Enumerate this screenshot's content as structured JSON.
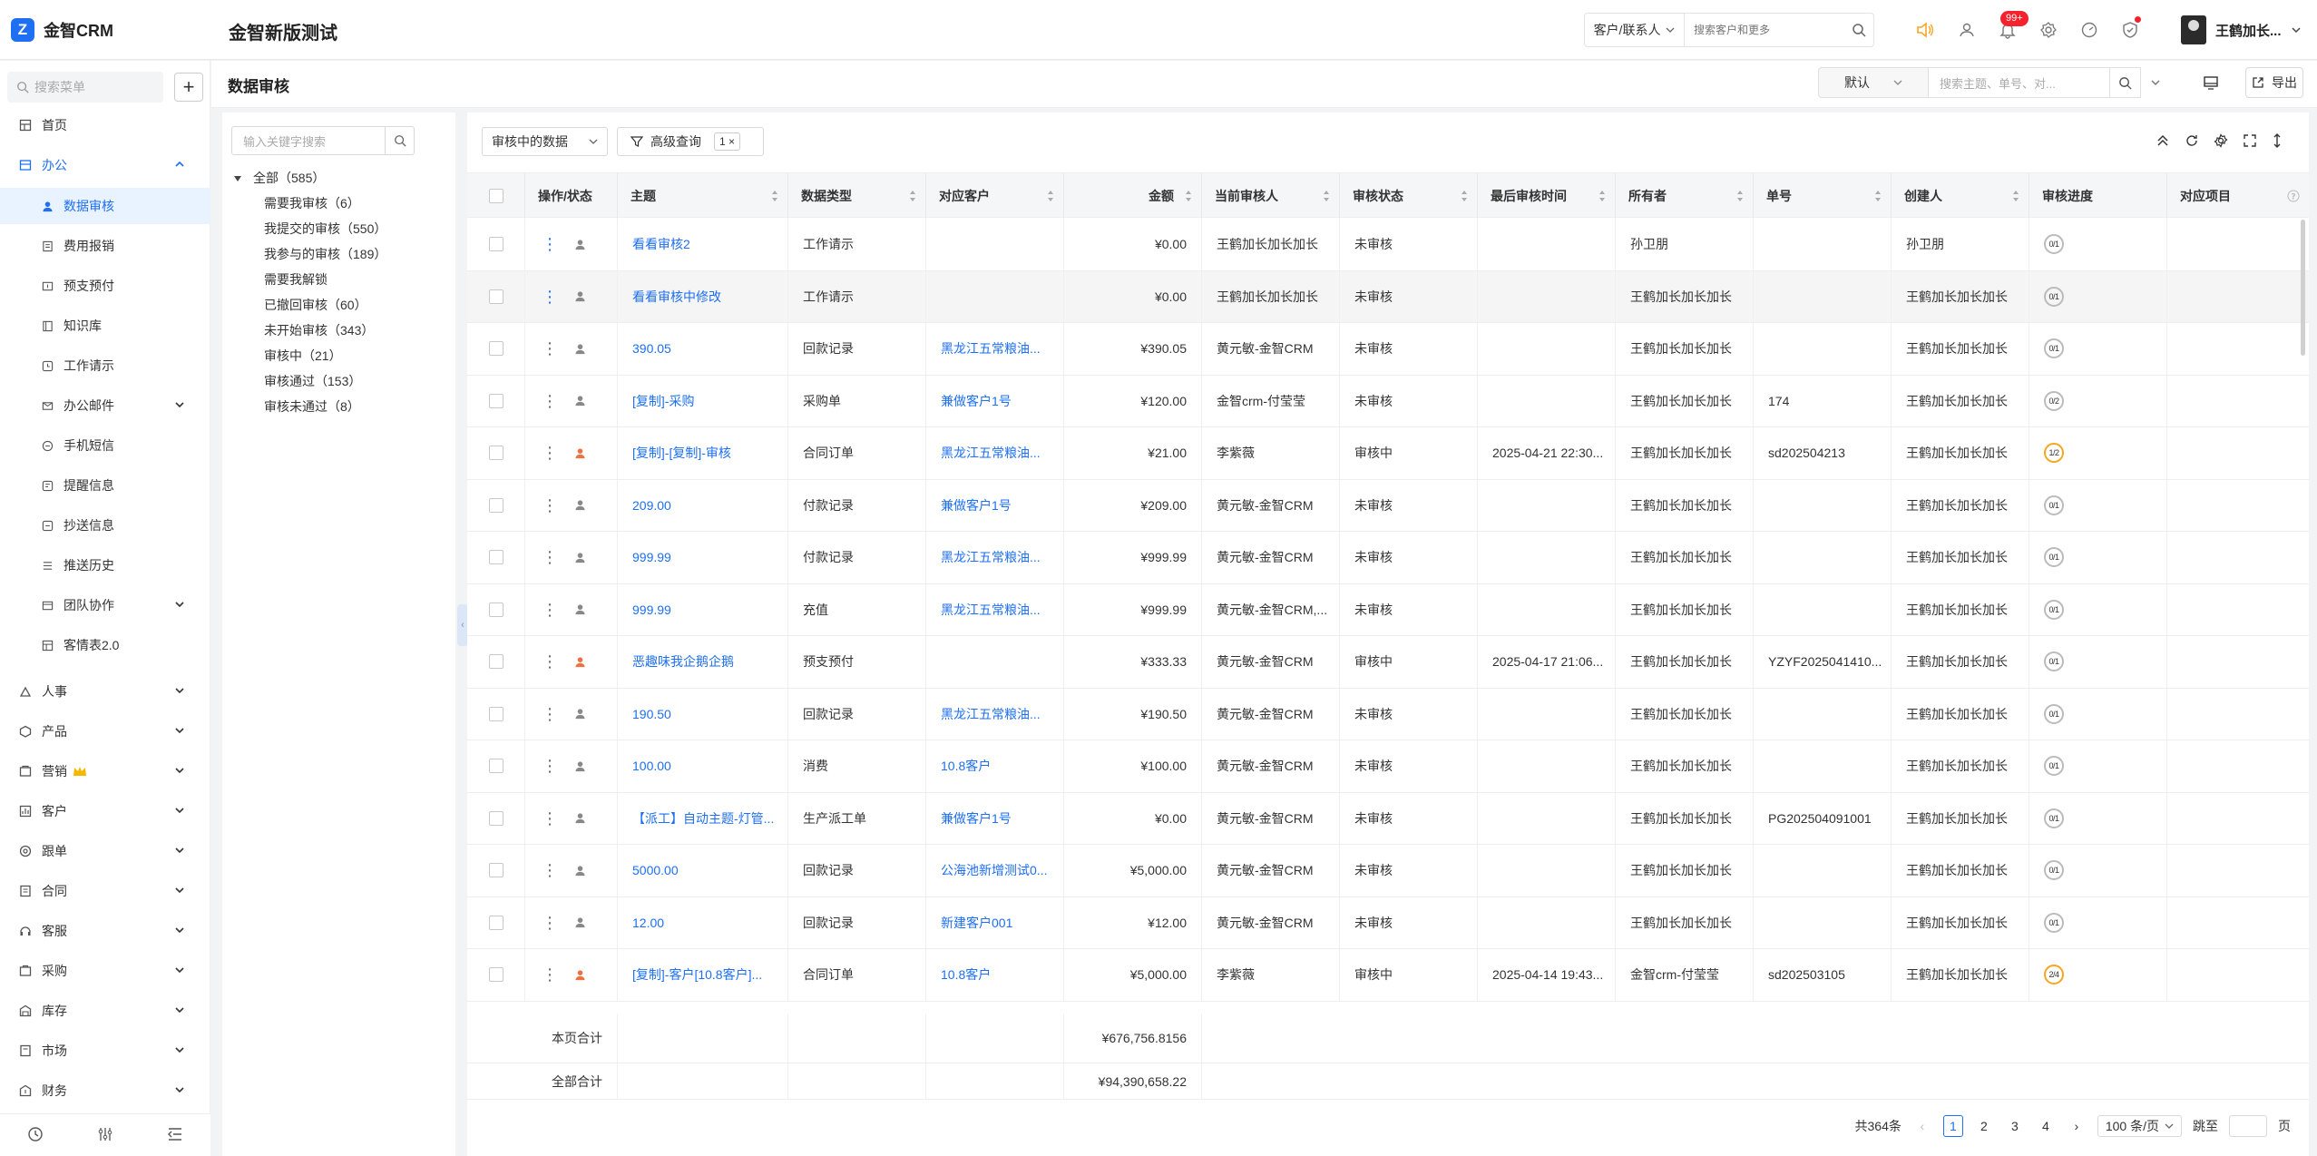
{
  "topbar": {
    "logo_text": "金智CRM",
    "app_title": "金智新版测试",
    "search_scope": "客户/联系人",
    "search_placeholder": "搜索客户和更多",
    "notif_badge": "99+",
    "user_name": "王鹤加长..."
  },
  "sidebar": {
    "search_placeholder": "搜索菜单",
    "add_label": "+",
    "home": "首页",
    "office": "办公",
    "office_items": [
      "数据审核",
      "费用报销",
      "预支预付",
      "知识库",
      "工作请示",
      "办公邮件",
      "手机短信",
      "提醒信息",
      "抄送信息",
      "推送历史",
      "团队协作",
      "客情表2.0"
    ],
    "modules": [
      "人事",
      "产品",
      "营销",
      "客户",
      "跟单",
      "合同",
      "客服",
      "采购",
      "库存",
      "市场",
      "财务"
    ]
  },
  "page": {
    "title": "数据审核",
    "view_select": "默认",
    "search_placeholder": "搜索主题、单号、对...",
    "export_label": "导出"
  },
  "filter_tree": {
    "search_placeholder": "输入关键字搜索",
    "root": "全部（585）",
    "items": [
      "需要我审核（6）",
      "我提交的审核（550）",
      "我参与的审核（189）",
      "需要我解锁",
      "已撤回审核（60）",
      "未开始审核（343）",
      "审核中（21）",
      "审核通过（153）",
      "审核未通过（8）"
    ]
  },
  "table": {
    "audit_select": "审核中的数据",
    "adv_query": "高级查询",
    "adv_query_count": "1 ×",
    "columns": [
      "操作/状态",
      "主题",
      "数据类型",
      "对应客户",
      "金额",
      "当前审核人",
      "审核状态",
      "最后审核时间",
      "所有者",
      "单号",
      "创建人",
      "审核进度",
      "对应项目"
    ],
    "rows": [
      {
        "subject": "看看审核2",
        "type": "工作请示",
        "customer": "",
        "amount": "¥0.00",
        "reviewer": "王鹤加长加长加长",
        "status": "未审核",
        "last_time": "",
        "owner": "孙卫朋",
        "no": "",
        "creator": "孙卫朋",
        "progress": "0/1"
      },
      {
        "subject": "看看审核中修改",
        "type": "工作请示",
        "customer": "",
        "amount": "¥0.00",
        "reviewer": "王鹤加长加长加长",
        "status": "未审核",
        "last_time": "",
        "owner": "王鹤加长加长加长",
        "no": "",
        "creator": "王鹤加长加长加长",
        "progress": "0/1"
      },
      {
        "subject": "390.05",
        "type": "回款记录",
        "customer": "黑龙江五常粮油...",
        "amount": "¥390.05",
        "reviewer": "黄元敏-金智CRM",
        "status": "未审核",
        "last_time": "",
        "owner": "王鹤加长加长加长",
        "no": "",
        "creator": "王鹤加长加长加长",
        "progress": "0/1"
      },
      {
        "subject": "[复制]-采购",
        "type": "采购单",
        "customer": "兼做客户1号",
        "amount": "¥120.00",
        "reviewer": "金智crm-付莹莹",
        "status": "未审核",
        "last_time": "",
        "owner": "王鹤加长加长加长",
        "no": "174",
        "creator": "王鹤加长加长加长",
        "progress": "0/2"
      },
      {
        "subject": "[复制]-[复制]-审核",
        "type": "合同订单",
        "customer": "黑龙江五常粮油...",
        "amount": "¥21.00",
        "reviewer": "李紫薇",
        "status": "审核中",
        "last_time": "2025-04-21 22:30...",
        "owner": "王鹤加长加长加长",
        "no": "sd202504213",
        "creator": "王鹤加长加长加长",
        "progress": "1/2"
      },
      {
        "subject": "209.00",
        "type": "付款记录",
        "customer": "兼做客户1号",
        "amount": "¥209.00",
        "reviewer": "黄元敏-金智CRM",
        "status": "未审核",
        "last_time": "",
        "owner": "王鹤加长加长加长",
        "no": "",
        "creator": "王鹤加长加长加长",
        "progress": "0/1"
      },
      {
        "subject": "999.99",
        "type": "付款记录",
        "customer": "黑龙江五常粮油...",
        "amount": "¥999.99",
        "reviewer": "黄元敏-金智CRM",
        "status": "未审核",
        "last_time": "",
        "owner": "王鹤加长加长加长",
        "no": "",
        "creator": "王鹤加长加长加长",
        "progress": "0/1"
      },
      {
        "subject": "999.99",
        "type": "充值",
        "customer": "黑龙江五常粮油...",
        "amount": "¥999.99",
        "reviewer": "黄元敏-金智CRM,...",
        "status": "未审核",
        "last_time": "",
        "owner": "王鹤加长加长加长",
        "no": "",
        "creator": "王鹤加长加长加长",
        "progress": "0/1"
      },
      {
        "subject": "恶趣味我企鹅企鹅",
        "type": "预支预付",
        "customer": "",
        "amount": "¥333.33",
        "reviewer": "黄元敏-金智CRM",
        "status": "审核中",
        "last_time": "2025-04-17 21:06...",
        "owner": "王鹤加长加长加长",
        "no": "YZYF2025041410...",
        "creator": "王鹤加长加长加长",
        "progress": "0/1"
      },
      {
        "subject": "190.50",
        "type": "回款记录",
        "customer": "黑龙江五常粮油...",
        "amount": "¥190.50",
        "reviewer": "黄元敏-金智CRM",
        "status": "未审核",
        "last_time": "",
        "owner": "王鹤加长加长加长",
        "no": "",
        "creator": "王鹤加长加长加长",
        "progress": "0/1"
      },
      {
        "subject": "100.00",
        "type": "消费",
        "customer": "10.8客户",
        "amount": "¥100.00",
        "reviewer": "黄元敏-金智CRM",
        "status": "未审核",
        "last_time": "",
        "owner": "王鹤加长加长加长",
        "no": "",
        "creator": "王鹤加长加长加长",
        "progress": "0/1"
      },
      {
        "subject": "【派工】自动主题-灯管...",
        "type": "生产派工单",
        "customer": "兼做客户1号",
        "amount": "¥0.00",
        "reviewer": "黄元敏-金智CRM",
        "status": "未审核",
        "last_time": "",
        "owner": "王鹤加长加长加长",
        "no": "PG202504091001",
        "creator": "王鹤加长加长加长",
        "progress": "0/1"
      },
      {
        "subject": "5000.00",
        "type": "回款记录",
        "customer": "公海池新增测试0...",
        "amount": "¥5,000.00",
        "reviewer": "黄元敏-金智CRM",
        "status": "未审核",
        "last_time": "",
        "owner": "王鹤加长加长加长",
        "no": "",
        "creator": "王鹤加长加长加长",
        "progress": "0/1"
      },
      {
        "subject": "12.00",
        "type": "回款记录",
        "customer": "新建客户001",
        "amount": "¥12.00",
        "reviewer": "黄元敏-金智CRM",
        "status": "未审核",
        "last_time": "",
        "owner": "王鹤加长加长加长",
        "no": "",
        "creator": "王鹤加长加长加长",
        "progress": "0/1"
      },
      {
        "subject": "[复制]-客户[10.8客户]...",
        "type": "合同订单",
        "customer": "10.8客户",
        "amount": "¥5,000.00",
        "reviewer": "李紫薇",
        "status": "审核中",
        "last_time": "2025-04-14 19:43...",
        "owner": "金智crm-付莹莹",
        "no": "sd202503105",
        "creator": "王鹤加长加长加长",
        "progress": "2/4"
      }
    ],
    "page_total_label": "本页合计",
    "page_total": "¥676,756.8156",
    "all_total_label": "全部合计",
    "all_total": "¥94,390,658.22"
  },
  "pager": {
    "total": "共364条",
    "pages": [
      "1",
      "2",
      "3",
      "4"
    ],
    "page_size": "100 条/页",
    "jump_label": "跳至",
    "page_suffix": "页"
  }
}
